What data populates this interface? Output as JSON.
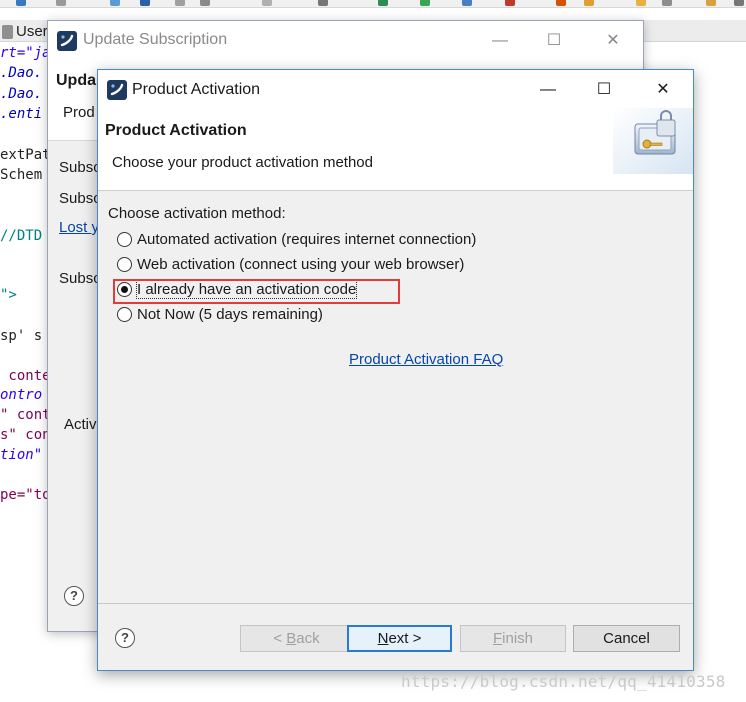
{
  "ide": {
    "tab_label": "User",
    "code_lines": [
      {
        "text": "rt=\"ja",
        "cls": "c-blue"
      },
      {
        "text": ".Dao.",
        "cls": "c-navy"
      },
      {
        "text": ".Dao.",
        "cls": "c-navy"
      },
      {
        "text": ".enti",
        "cls": "c-navy"
      },
      {
        "text": "extPat",
        "cls": "c-dark"
      },
      {
        "text": "Schem",
        "cls": "c-dark"
      },
      {
        "text": "//DTD",
        "cls": "c-teal"
      },
      {
        "text": "\">",
        "cls": "c-teal"
      },
      {
        "text": "sp' s",
        "cls": "c-dark"
      },
      {
        "text": " conte",
        "cls": "c-purple"
      },
      {
        "text": "ontro",
        "cls": "c-blue"
      },
      {
        "text": "\" cont",
        "cls": "c-purple"
      },
      {
        "text": "s\" con",
        "cls": "c-purple"
      },
      {
        "text": "tion\"",
        "cls": "c-blue"
      },
      {
        "text": "pe=\"to",
        "cls": "c-purple"
      }
    ]
  },
  "update_window": {
    "title": "Update Subscription",
    "header_title": "Upda",
    "header_sub": "Prod",
    "labels": [
      "Subsc",
      "Subsc",
      "Subsc",
      "Activ"
    ],
    "lost_link": "Lost y",
    "help_symbol": "?"
  },
  "dialog": {
    "title": "Product Activation",
    "header_title": "Product Activation",
    "header_subtitle": "Choose your product activation method",
    "method_label": "Choose activation method:",
    "options": [
      {
        "label": "Automated activation (requires internet connection)",
        "checked": false
      },
      {
        "label": "Web activation (connect using your web browser)",
        "checked": false
      },
      {
        "label": "I already have an activation code",
        "checked": true
      },
      {
        "label": "Not Now (5 days remaining)",
        "checked": false
      }
    ],
    "faq_link": "Product Activation FAQ",
    "help_symbol": "?",
    "buttons": {
      "back": {
        "prefix": "< ",
        "mnemonic": "B",
        "rest": "ack"
      },
      "next": {
        "mnemonic": "N",
        "rest": "ext >"
      },
      "finish": {
        "mnemonic": "F",
        "rest": "inish"
      },
      "cancel": "Cancel"
    },
    "window_controls": {
      "minimize": "—",
      "maximize": "☐",
      "close": "✕"
    }
  },
  "watermark": "https://blog.csdn.net/qq_41410358",
  "colors": {
    "highlight": "#e33a3a",
    "link": "#0645ad",
    "default_button_border": "#2a7ad2"
  }
}
